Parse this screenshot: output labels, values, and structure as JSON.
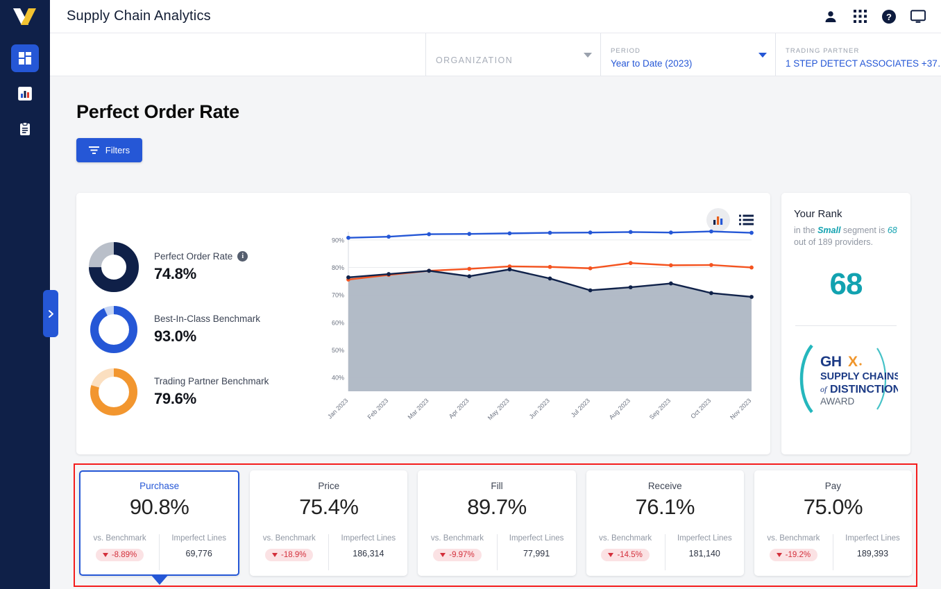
{
  "header": {
    "title": "Supply Chain Analytics",
    "icons": [
      "person-icon",
      "apps-grid-icon",
      "help-icon",
      "monitor-icon"
    ]
  },
  "sidebar": {
    "logo": "x-logo",
    "items": [
      {
        "name": "dashboard",
        "icon": "dashboard-icon",
        "active": true
      },
      {
        "name": "analytics",
        "icon": "bar-chart-icon",
        "active": false
      },
      {
        "name": "reports",
        "icon": "clipboard-icon",
        "active": false
      }
    ],
    "expand_handle": "chevron-right-icon"
  },
  "filterbar": {
    "organization": {
      "label": "ORGANIZATION",
      "value": "",
      "placeholder": "ORGANIZATION"
    },
    "period": {
      "label": "PERIOD",
      "value": "Year to Date (2023)"
    },
    "trading_partner": {
      "label": "TRADING PARTNER",
      "value": "1 STEP DETECT ASSOCIATES +37…"
    }
  },
  "page": {
    "title": "Perfect Order Rate",
    "filters_button": "Filters"
  },
  "chart_card": {
    "toggles": {
      "chart_view": "bar-chart-icon",
      "list_view": "list-icon"
    },
    "metrics": [
      {
        "label": "Perfect Order Rate",
        "value": "74.8%",
        "percent": 74.8,
        "color": "#0f2048",
        "track": "#b9bfc9",
        "has_info": true
      },
      {
        "label": "Best-In-Class Benchmark",
        "value": "93.0%",
        "percent": 93.0,
        "color": "#2557d6",
        "track": "#c6d5f3",
        "has_info": false
      },
      {
        "label": "Trading Partner Benchmark",
        "value": "79.6%",
        "percent": 79.6,
        "color": "#f2962f",
        "track": "#fbdfc0",
        "has_info": false
      }
    ]
  },
  "chart_data": {
    "type": "line",
    "title": "",
    "xlabel": "",
    "ylabel": "",
    "ylim": [
      35,
      93
    ],
    "yticks": [
      "40%",
      "50%",
      "60%",
      "70%",
      "80%",
      "90%"
    ],
    "ytick_values": [
      40,
      50,
      60,
      70,
      80,
      90
    ],
    "grid": true,
    "legend": "none",
    "categories": [
      "Jan 2023",
      "Feb 2023",
      "Mar 2023",
      "Apr 2023",
      "May 2023",
      "Jun 2023",
      "Jul 2023",
      "Aug 2023",
      "Sep 2023",
      "Oct 2023",
      "Nov 2023"
    ],
    "series": [
      {
        "name": "Best-In-Class Benchmark",
        "color": "#2557d6",
        "values": [
          90.8,
          91.2,
          92.1,
          92.2,
          92.4,
          92.6,
          92.7,
          92.9,
          92.7,
          93.1,
          92.6
        ]
      },
      {
        "name": "Trading Partner Benchmark",
        "color": "#f4531f",
        "values": [
          75.6,
          77.3,
          78.8,
          79.5,
          80.4,
          80.2,
          79.7,
          81.6,
          80.8,
          80.9,
          80.0
        ]
      },
      {
        "name": "Perfect Order Rate",
        "color": "#10224a",
        "area": "#aeb7c4",
        "values": [
          76.4,
          77.6,
          78.8,
          76.8,
          79.3,
          76.0,
          71.7,
          72.8,
          74.2,
          70.7,
          69.3
        ]
      }
    ]
  },
  "rank_card": {
    "title": "Your Rank",
    "sub_prefix": "in the ",
    "segment": "Small",
    "sub_mid": " segment is ",
    "rank_inline": "68",
    "sub_suffix": " out of 189 providers.",
    "rank_value": "68",
    "accent": "#12a2b0",
    "award": {
      "brand": "GHX",
      "line1": "SUPPLY CHAINS",
      "line2_small": "of",
      "line2": "DISTINCTION",
      "line3": "AWARD"
    }
  },
  "kpis": [
    {
      "name": "Purchase",
      "value": "90.8%",
      "benchmark_label": "vs. Benchmark",
      "benchmark": "-8.89%",
      "lines_label": "Imperfect Lines",
      "lines": "69,776",
      "selected": true
    },
    {
      "name": "Price",
      "value": "75.4%",
      "benchmark_label": "vs. Benchmark",
      "benchmark": "-18.9%",
      "lines_label": "Imperfect Lines",
      "lines": "186,314",
      "selected": false
    },
    {
      "name": "Fill",
      "value": "89.7%",
      "benchmark_label": "vs. Benchmark",
      "benchmark": "-9.97%",
      "lines_label": "Imperfect Lines",
      "lines": "77,991",
      "selected": false
    },
    {
      "name": "Receive",
      "value": "76.1%",
      "benchmark_label": "vs. Benchmark",
      "benchmark": "-14.5%",
      "lines_label": "Imperfect Lines",
      "lines": "181,140",
      "selected": false
    },
    {
      "name": "Pay",
      "value": "75.0%",
      "benchmark_label": "vs. Benchmark",
      "benchmark": "-19.2%",
      "lines_label": "Imperfect Lines",
      "lines": "189,393",
      "selected": false
    }
  ],
  "colors": {
    "brand_blue": "#2557d6",
    "navy": "#0f2048",
    "orange": "#f4531f",
    "teal": "#12a2b0",
    "highlight_border": "#f41c1c"
  }
}
